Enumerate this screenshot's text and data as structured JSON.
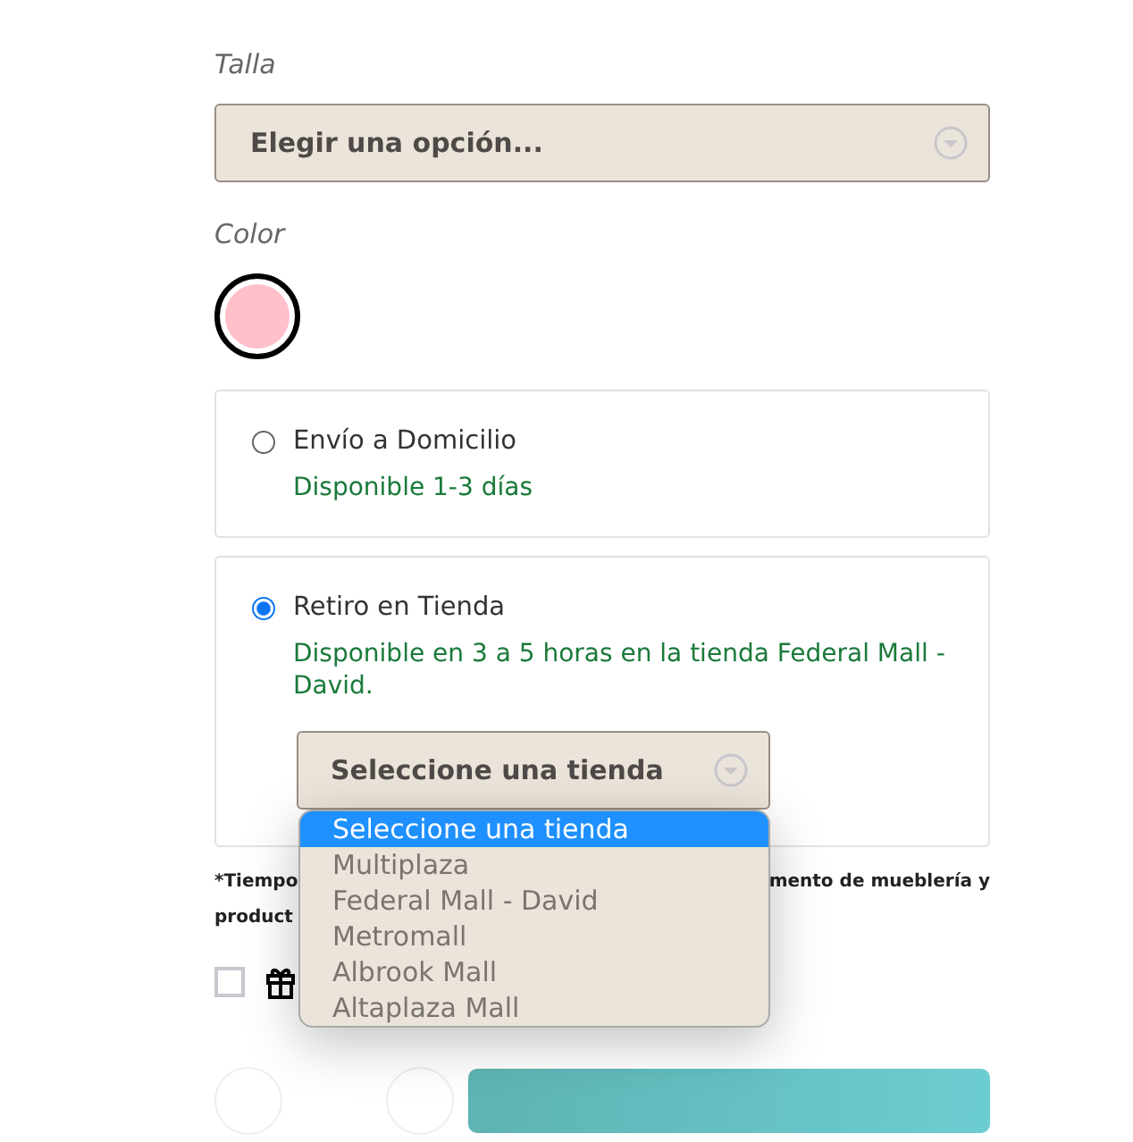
{
  "size": {
    "label": "Talla",
    "placeholder": "Elegir una opción..."
  },
  "color": {
    "label": "Color",
    "swatches": [
      {
        "color": "#ffc0cb",
        "selected": true
      }
    ]
  },
  "delivery_options": [
    {
      "label": "Envío a Domicilio",
      "availability": "Disponible 1-3 días",
      "selected": false
    },
    {
      "label": "Retiro en Tienda",
      "availability": "Disponible en 3 a 5 horas en la tienda Federal Mall - David.",
      "selected": true,
      "store_select": {
        "value": "Seleccione una tienda",
        "expanded": true,
        "options": [
          {
            "label": "Seleccione una tienda",
            "selected": true
          },
          {
            "label": "Multiplaza",
            "selected": false
          },
          {
            "label": "Federal Mall - David",
            "selected": false
          },
          {
            "label": "Metromall",
            "selected": false
          },
          {
            "label": "Albrook Mall",
            "selected": false
          },
          {
            "label": "Altaplaza Mall",
            "selected": false
          }
        ]
      }
    }
  ],
  "note": {
    "line_1_start": "*Tiempo",
    "line_1_end": "mento de mueblería y",
    "line_2_start": "product"
  },
  "gift_checkbox": {
    "checked": false
  }
}
